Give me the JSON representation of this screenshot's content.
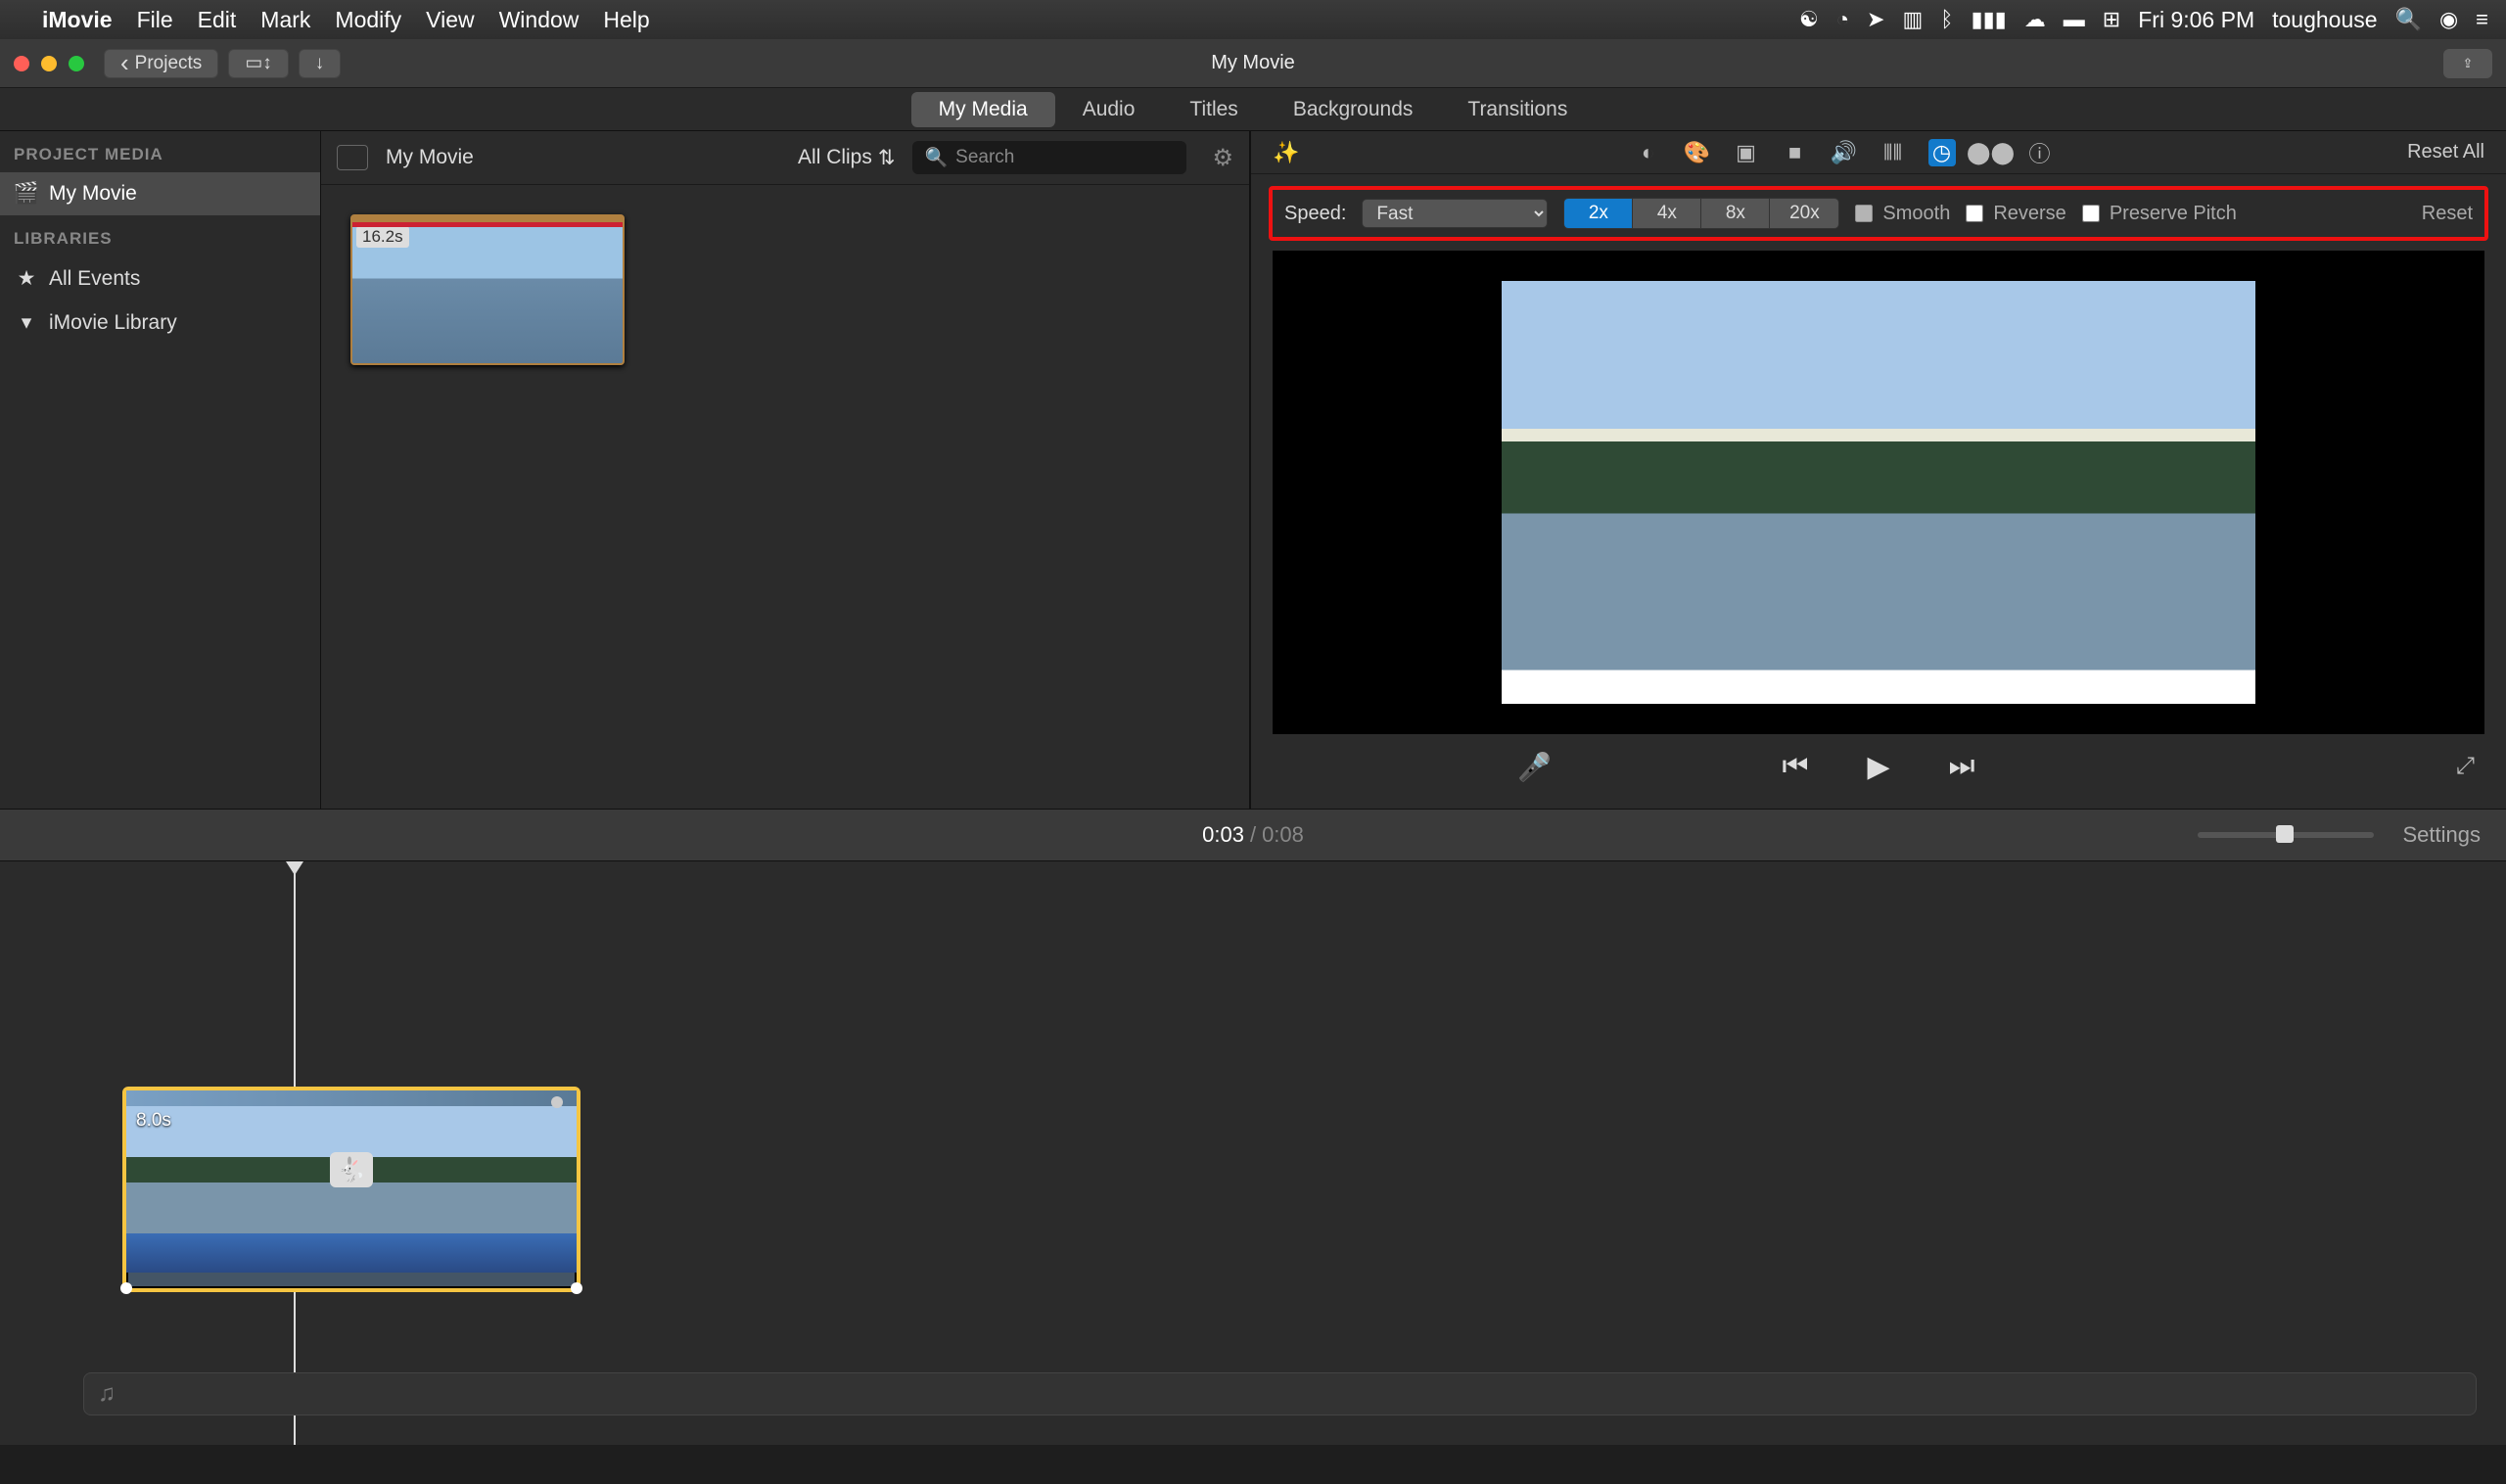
{
  "menubar": {
    "app": "iMovie",
    "items": [
      "File",
      "Edit",
      "Mark",
      "Modify",
      "View",
      "Window",
      "Help"
    ],
    "clock": "Fri 9:06 PM",
    "user": "toughouse"
  },
  "titlebar": {
    "back_label": "Projects",
    "title": "My Movie"
  },
  "tabs": {
    "items": [
      "My Media",
      "Audio",
      "Titles",
      "Backgrounds",
      "Transitions"
    ],
    "active": 0
  },
  "sidebar": {
    "sections": {
      "project_media": "PROJECT MEDIA",
      "libraries": "LIBRARIES"
    },
    "project_item": "My Movie",
    "all_events": "All Events",
    "imovie_library": "iMovie Library"
  },
  "browser": {
    "title": "My Movie",
    "filter_label": "All Clips",
    "search_placeholder": "Search",
    "clip_duration": "16.2s"
  },
  "inspector": {
    "reset_all": "Reset All",
    "speed_label": "Speed:",
    "speed_value": "Fast",
    "multipliers": [
      "2x",
      "4x",
      "8x",
      "20x"
    ],
    "active_multiplier": 0,
    "smooth": "Smooth",
    "reverse": "Reverse",
    "preserve_pitch": "Preserve Pitch",
    "reset": "Reset"
  },
  "timecode": {
    "current": "0:03",
    "total": "0:08",
    "settings": "Settings"
  },
  "timeline": {
    "clip_duration": "8.0s"
  }
}
